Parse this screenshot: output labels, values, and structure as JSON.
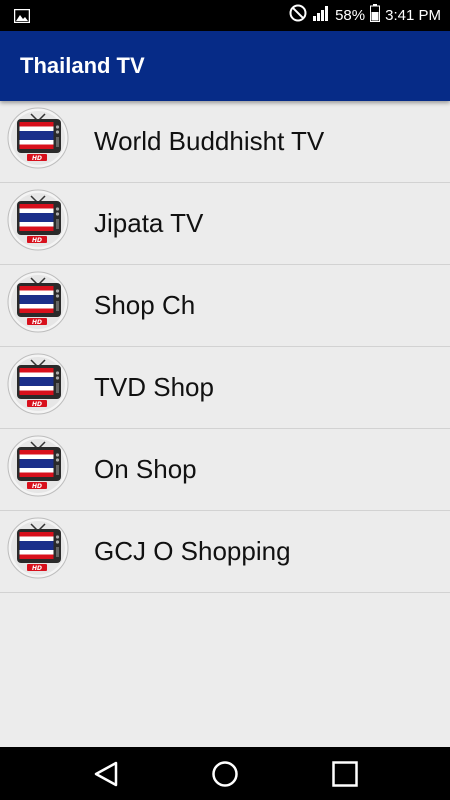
{
  "status_bar": {
    "battery": "58%",
    "time": "3:41 PM",
    "icons": [
      "image-icon",
      "do-not-disturb-icon",
      "signal-icon",
      "battery-icon"
    ]
  },
  "app_bar": {
    "title": "Thailand TV"
  },
  "channels": [
    {
      "name": "World Buddhisht TV",
      "icon": "thai-flag-tv-icon"
    },
    {
      "name": "Jipata TV",
      "icon": "thai-flag-tv-icon"
    },
    {
      "name": "Shop Ch",
      "icon": "thai-flag-tv-icon"
    },
    {
      "name": "TVD Shop",
      "icon": "thai-flag-tv-icon"
    },
    {
      "name": "On Shop",
      "icon": "thai-flag-tv-icon"
    },
    {
      "name": "GCJ O Shopping",
      "icon": "thai-flag-tv-icon"
    }
  ],
  "nav_bar": {
    "icons": [
      "back-icon",
      "home-icon",
      "recents-icon"
    ]
  },
  "colors": {
    "app_bar": "#062b87",
    "background": "#ececec",
    "flag_red": "#d8101c",
    "flag_blue": "#1b2f8a"
  }
}
